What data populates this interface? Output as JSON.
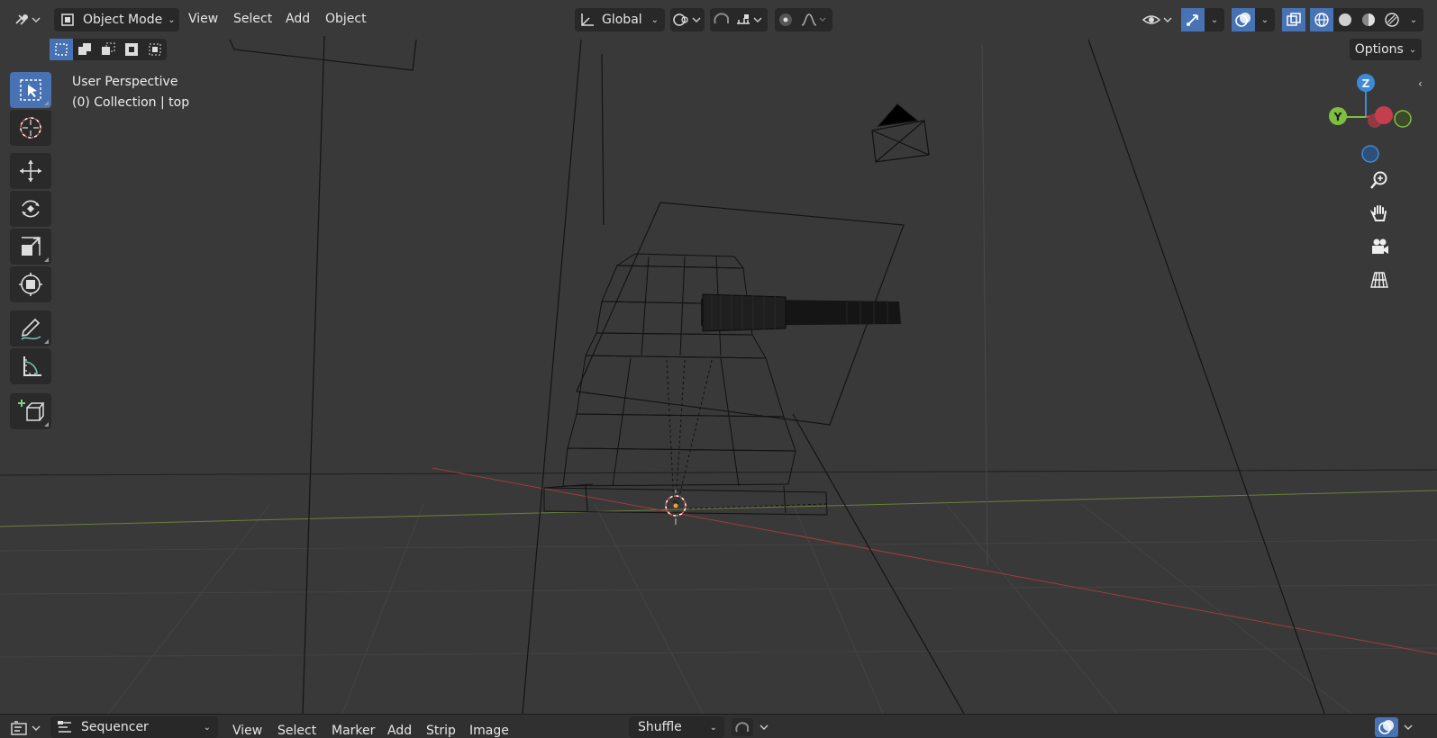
{
  "header": {
    "mode_label": "Object Mode",
    "menus": [
      "View",
      "Select",
      "Add",
      "Object"
    ],
    "orientation_label": "Global",
    "options_label": "Options"
  },
  "overlay": {
    "view_name": "User Perspective",
    "collection_label": "(0) Collection | top"
  },
  "gizmo": {
    "z": "Z",
    "y": "Y"
  },
  "footer": {
    "editor_label": "Sequencer",
    "menus": [
      "View",
      "Select",
      "Marker",
      "Add",
      "Strip",
      "Image"
    ],
    "view_mode_label": "Shuffle"
  },
  "icons": {
    "editor_type": "editor-type-icon",
    "mode": "object-mode-icon",
    "transform": "transform-orientation-icon",
    "pivot": "pivot-point-icon",
    "snap": "snap-icon",
    "proportional": "proportional-editing-icon",
    "falloff": "falloff-icon",
    "visibility": "visibility-icon",
    "gizmo": "gizmo-toggle-icon",
    "overlay": "overlay-toggle-icon",
    "xray": "xray-icon"
  },
  "colors": {
    "accent": "#4772b3",
    "x_axis": "#e04a5a",
    "y_axis": "#7fbf3f",
    "z_axis": "#3d8ad6"
  }
}
